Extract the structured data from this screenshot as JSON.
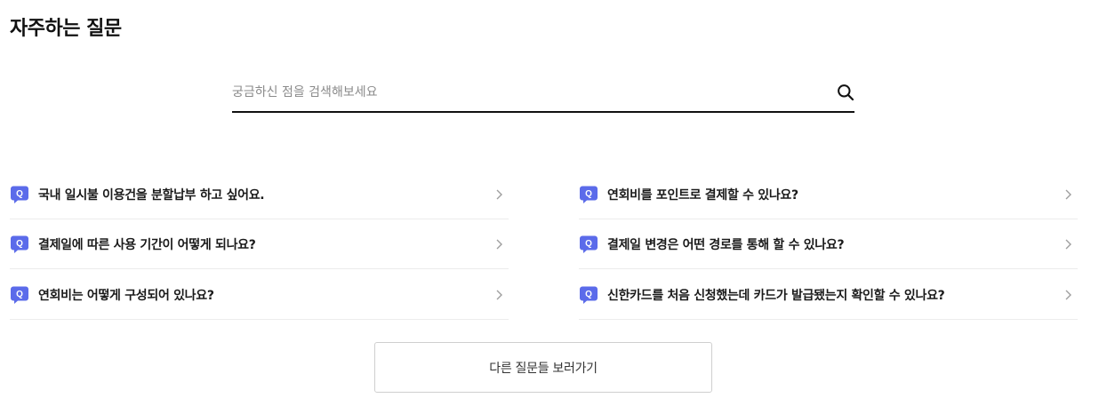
{
  "page": {
    "title": "자주하는 질문"
  },
  "search": {
    "placeholder": "궁금하신 점을 검색해보세요",
    "value": "",
    "icon": "search-icon"
  },
  "faq": {
    "badge_letter": "Q",
    "badge_color": "#5b6bea",
    "left": [
      {
        "question": "국내 일시불 이용건을 분할납부 하고 싶어요."
      },
      {
        "question": "결제일에 따른 사용 기간이 어떻게 되나요?"
      },
      {
        "question": "연회비는 어떻게 구성되어 있나요?"
      }
    ],
    "right": [
      {
        "question": "연회비를 포인트로 결제할 수 있나요?"
      },
      {
        "question": "결제일 변경은 어떤 경로를 통해 할 수 있나요?"
      },
      {
        "question": "신한카드를 처음 신청했는데 카드가 발급됐는지 확인할 수 있나요?"
      }
    ]
  },
  "more_button": {
    "label": "다른 질문들 보러가기"
  }
}
